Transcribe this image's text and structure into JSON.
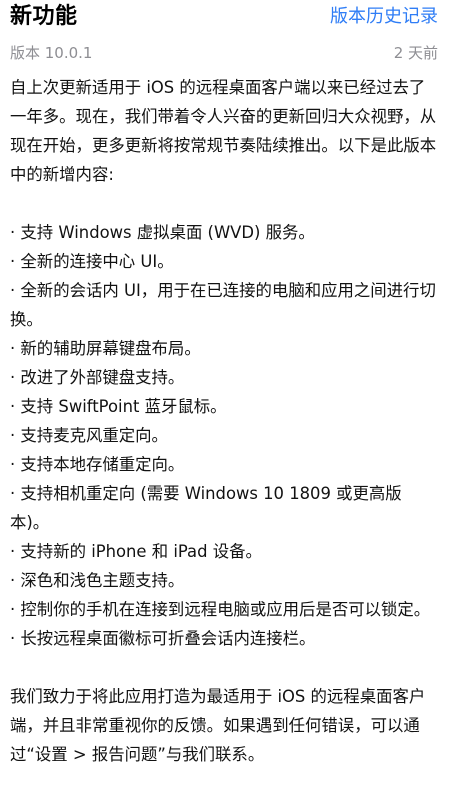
{
  "header": {
    "title": "新功能",
    "history_link": "版本历史记录"
  },
  "meta": {
    "version": "版本 10.0.1",
    "released": "2 天前"
  },
  "intro": "自上次更新适用于 iOS 的远程桌面客户端以来已经过去了一年多。现在，我们带着令人兴奋的更新回归大众视野，从现在开始，更多更新将按常规节奏陆续推出。以下是此版本中的新增内容:",
  "features": [
    "· 支持 Windows 虚拟桌面 (WVD) 服务。",
    "· 全新的连接中心 UI。",
    "· 全新的会话内 UI，用于在已连接的电脑和应用之间进行切换。",
    "· 新的辅助屏幕键盘布局。",
    "· 改进了外部键盘支持。",
    "· 支持 SwiftPoint 蓝牙鼠标。",
    "· 支持麦克风重定向。",
    "· 支持本地存储重定向。",
    "· 支持相机重定向 (需要 Windows 10 1809 或更高版本)。",
    "· 支持新的 iPhone 和 iPad 设备。",
    "· 深色和浅色主题支持。",
    "· 控制你的手机在连接到远程电脑或应用后是否可以锁定。",
    "· 长按远程桌面徽标可折叠会话内连接栏。"
  ],
  "closing": "我们致力于将此应用打造为最适用于 iOS 的远程桌面客户端，并且非常重视你的反馈。如果遇到任何错误，可以通过“设置 > 报告问题”与我们联系。"
}
